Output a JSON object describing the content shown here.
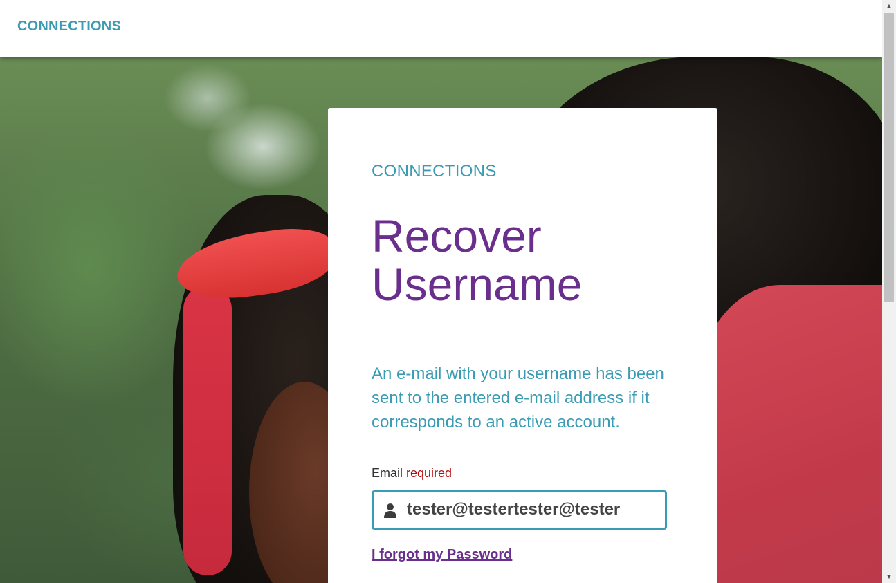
{
  "header": {
    "brand": "CONNECTIONS"
  },
  "card": {
    "brand": "CONNECTIONS",
    "title_line1": "Recover",
    "title_line2": "Username",
    "message": "An e-mail with your username has been sent to the entered e-mail address if it corresponds to an active account.",
    "email_label": "Email",
    "email_required": "required",
    "email_value": "tester@testertester@tester",
    "forgot_password_link": "I forgot my Password"
  },
  "icons": {
    "email_field_icon": "user-icon",
    "scroll_up": "up-arrow-icon",
    "scroll_down": "down-arrow-icon"
  },
  "colors": {
    "brand": "#3a9bb3",
    "title": "#6a2f8c",
    "required": "#b00d0d",
    "link": "#6a2f8c"
  }
}
